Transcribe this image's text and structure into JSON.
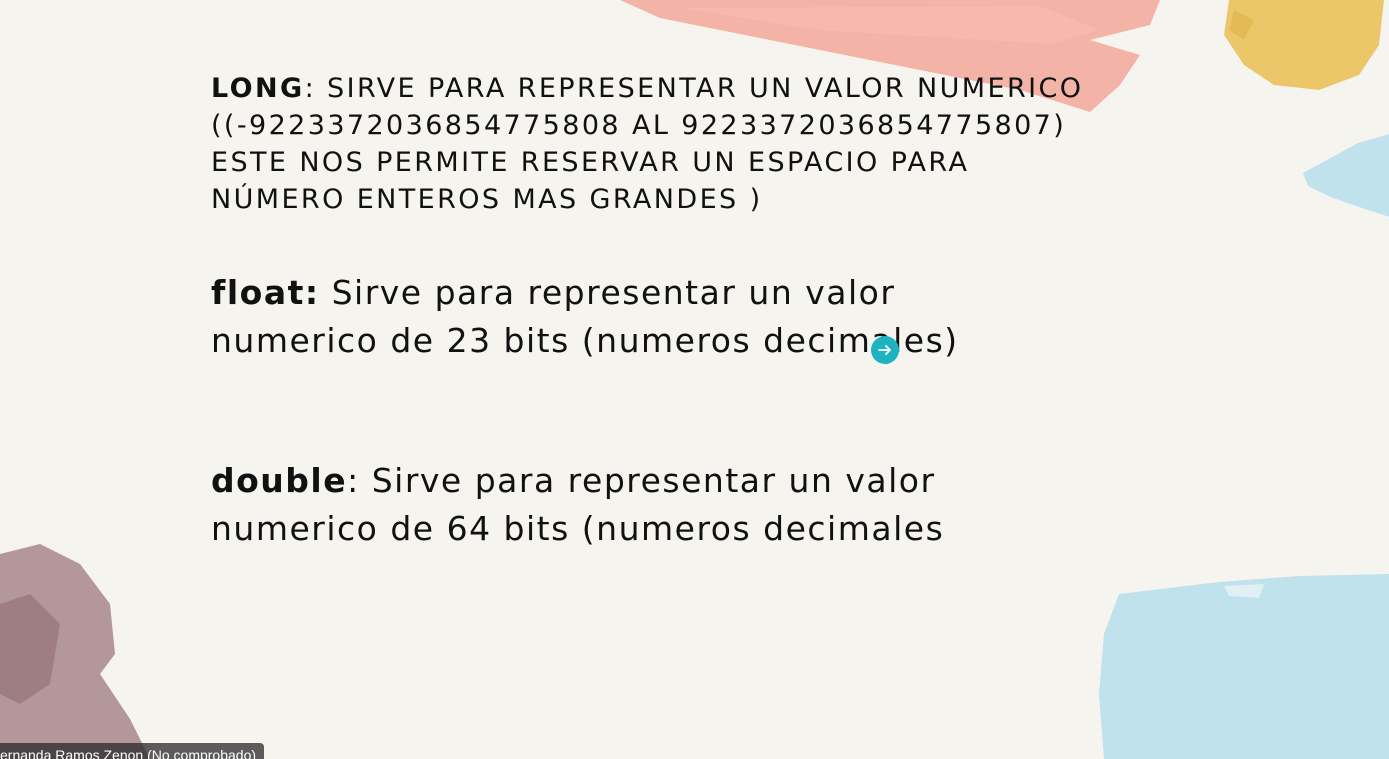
{
  "slide": {
    "long": {
      "keyword": "LONG",
      "line1_rest": ": SIRVE PARA REPRESENTAR UN VALOR NUMERICO",
      "line2": "((-9223372036854775808 AL 9223372036854775807)",
      "line3": "ESTE NOS PERMITE RESERVAR UN ESPACIO PARA",
      "line4": "NÚMERO ENTEROS MAS GRANDES )"
    },
    "float": {
      "keyword": "float:",
      "line1_rest": " Sirve para representar un valor",
      "line2": "numerico de 23 bits (numeros decimales)"
    },
    "double": {
      "keyword": "double",
      "line1_rest": ": Sirve para representar un valor",
      "line2": "numerico de 64 bits (numeros decimales"
    }
  },
  "participant": {
    "name_label": "ernanda Ramos Zenon (No comprobado)"
  },
  "colors": {
    "background": "#f6f4ef",
    "brush_pink": "#f3a79a",
    "brush_yellow": "#ecc76a",
    "brush_blue": "#bfe2ec",
    "brush_mauve": "#a8868c",
    "cursor_teal": "#1fb3c2"
  },
  "icons": {
    "cursor": "arrow-right-cursor-icon"
  }
}
